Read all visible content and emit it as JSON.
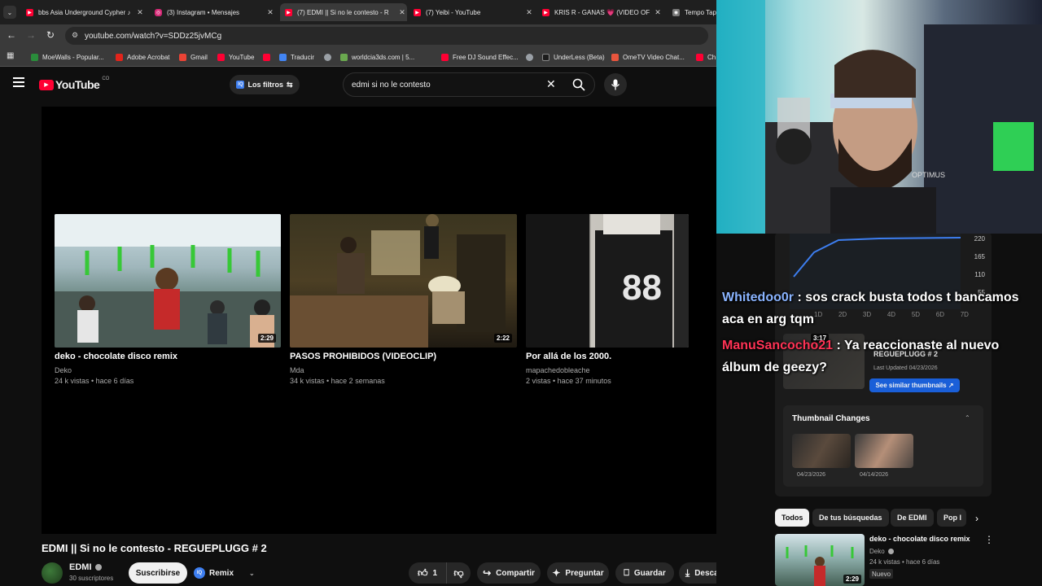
{
  "browser": {
    "tabs": [
      {
        "label": "bbs Asia Underground Cypher ♪",
        "color": "#ff0033"
      },
      {
        "label": "(3) Instagram • Mensajes",
        "color": "#d62976"
      },
      {
        "label": "(7) EDMI || Si no le contesto - R",
        "color": "#ff0033"
      },
      {
        "label": "(7) Yeibi - YouTube",
        "color": "#ff0033"
      },
      {
        "label": "KRIS R - GANAS 💗 (VIDEO OF",
        "color": "#ff0033"
      },
      {
        "label": "Tempo Tap",
        "color": "#888888"
      }
    ],
    "url": "youtube.com/watch?v=SDDz25jvMCg",
    "bookmarks": [
      "MoeWalls - Popular...",
      "Adobe Acrobat",
      "Gmail",
      "YouTube",
      "",
      "Traducir",
      "",
      "worldcia3ds.com | 5...",
      "Free DJ Sound Effec...",
      "",
      "UnderLess (Beta)",
      "OmeTV Video Chat...",
      "Ch"
    ]
  },
  "youtube": {
    "logo_text": "YouTube",
    "logo_sup": "CO",
    "filters_label": "Los filtros",
    "search_value": "edmi si no le contesto"
  },
  "end_screen": [
    {
      "title": "deko - chocolate disco remix",
      "channel": "Deko",
      "meta": "24 k vistas • hace 6 días",
      "duration": "2:29"
    },
    {
      "title": "PASOS PROHIBIDOS (VIDEOCLIP)",
      "channel": "Mda",
      "meta": "34 k vistas • hace 2 semanas",
      "duration": "2:22"
    },
    {
      "title": "Por allá de los 2000.",
      "channel": "mapachedobleache",
      "meta": "2 vistas • hace 37 minutos",
      "duration": ""
    }
  ],
  "video": {
    "title": "EDMI || Si no le contesto - REGUEPLUGG # 2",
    "channel": "EDMI",
    "subscribers": "30 suscriptores",
    "subscribe_label": "Suscribirse",
    "remix_label": "Remix",
    "likes": "1",
    "share_label": "Compartir",
    "ask_label": "Preguntar",
    "save_label": "Guardar",
    "download_label": "Descargar"
  },
  "stats_panel": {
    "y_ticks": [
      "220",
      "165",
      "110",
      "55"
    ],
    "x_ticks": [
      "1D",
      "2D",
      "3D",
      "4D",
      "5D",
      "6D",
      "7D"
    ],
    "thumb_duration": "3:17",
    "thumb_title": "REGUEPLUGG # 2",
    "thumb_updated": "Last Updated 04/23/2026",
    "similar_label": "See similar thumbnails ↗",
    "changes_title": "Thumbnail Changes",
    "change_dates": [
      "04/23/2026",
      "04/14/2026"
    ]
  },
  "chips": [
    "Todos",
    "De tus búsquedas",
    "De EDMI",
    "Pop l"
  ],
  "sidebar_video": {
    "title": "deko - chocolate disco remix",
    "channel": "Deko",
    "meta": "24 k vistas • hace 6 días",
    "badge": "Nuevo",
    "duration": "2:29"
  },
  "chat": [
    {
      "user": "Whitedoo0r",
      "user_color": "#8ab4ff",
      "message": " : sos crack busta todos t bancamos aca en arg tqm"
    },
    {
      "user": "ManuSancocho21",
      "user_color": "#ff3355",
      "message": " : Ya reaccionaste al nuevo álbum de geezy?"
    }
  ],
  "webcam": {
    "sign_text": "OPTIMUS"
  }
}
